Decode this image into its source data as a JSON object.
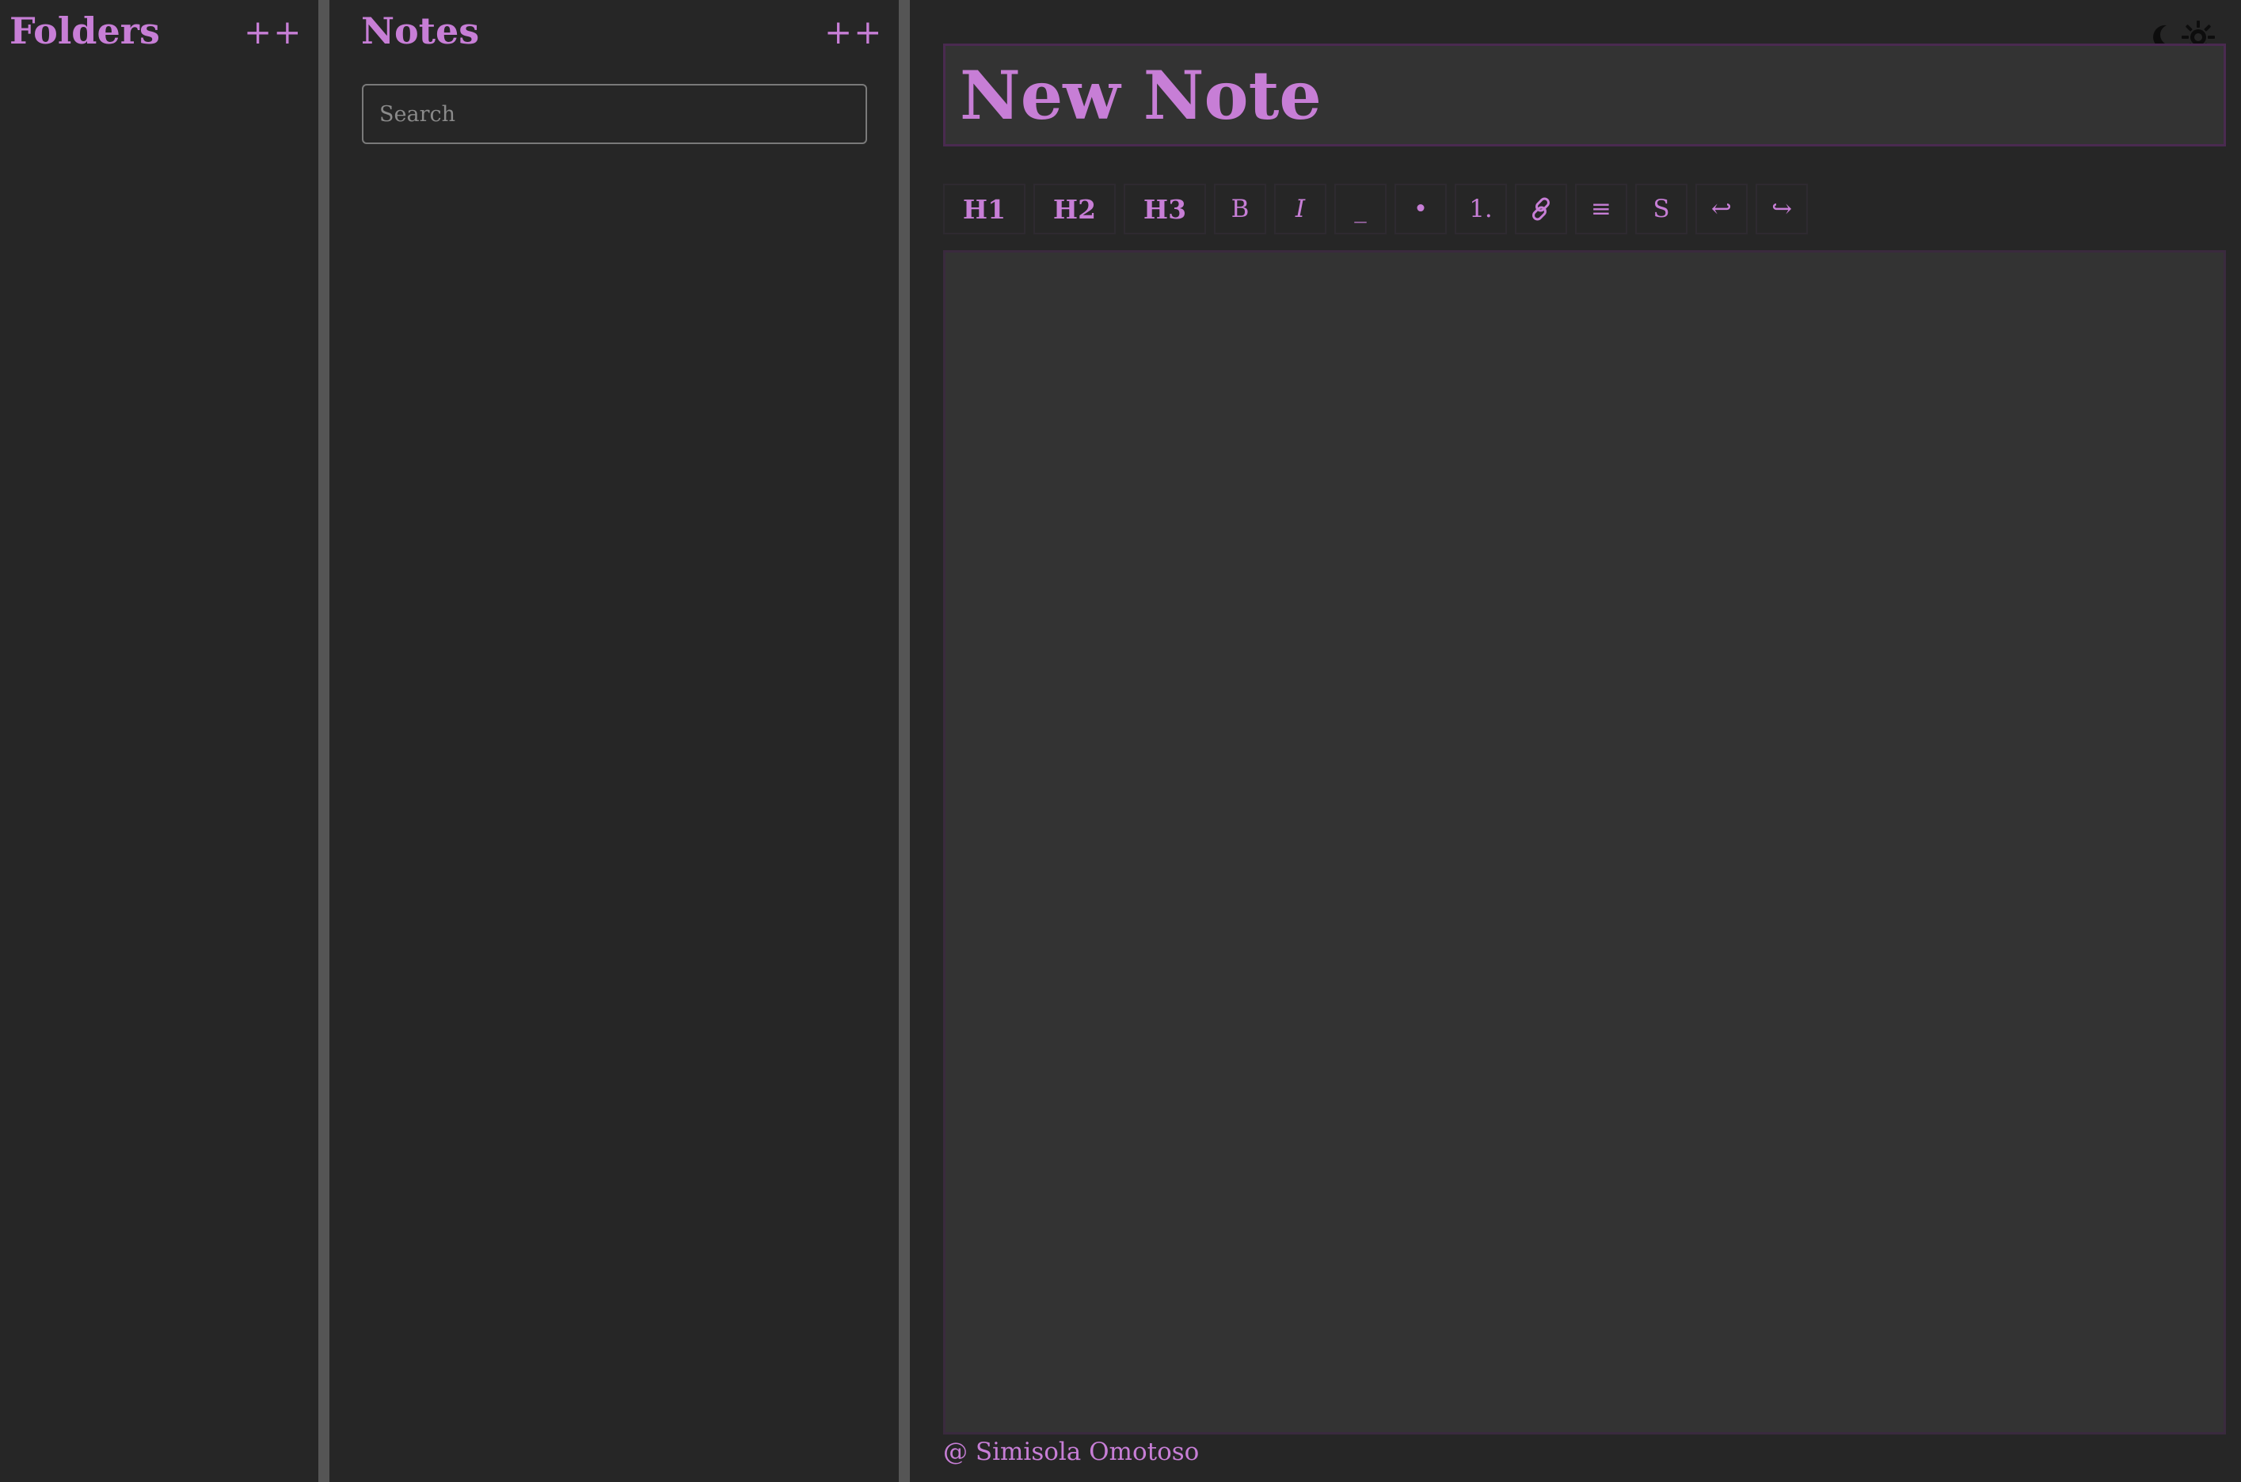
{
  "folders": {
    "title": "Folders",
    "add_label": "++"
  },
  "notes": {
    "title": "Notes",
    "add_label": "++",
    "search": {
      "placeholder": "Search",
      "value": ""
    }
  },
  "editor": {
    "theme_toggle": {
      "icons": [
        "moon-icon",
        "sun-icon"
      ]
    },
    "title_value": "New Note",
    "toolbar": {
      "h1": "H1",
      "h2": "H2",
      "h3": "H3",
      "bold": "B",
      "italic": "I",
      "underline": "_",
      "bullet": "•",
      "ordered": "1.",
      "link_icon": "link-icon",
      "align": "≡",
      "strike": "S",
      "undo": "↩",
      "redo": "↪"
    },
    "body_value": ""
  },
  "footer": {
    "text": "@ Simisola Omotoso"
  },
  "colors": {
    "accent": "#c77ed6",
    "background": "#262626",
    "panel": "#333333",
    "divider": "#555555"
  }
}
